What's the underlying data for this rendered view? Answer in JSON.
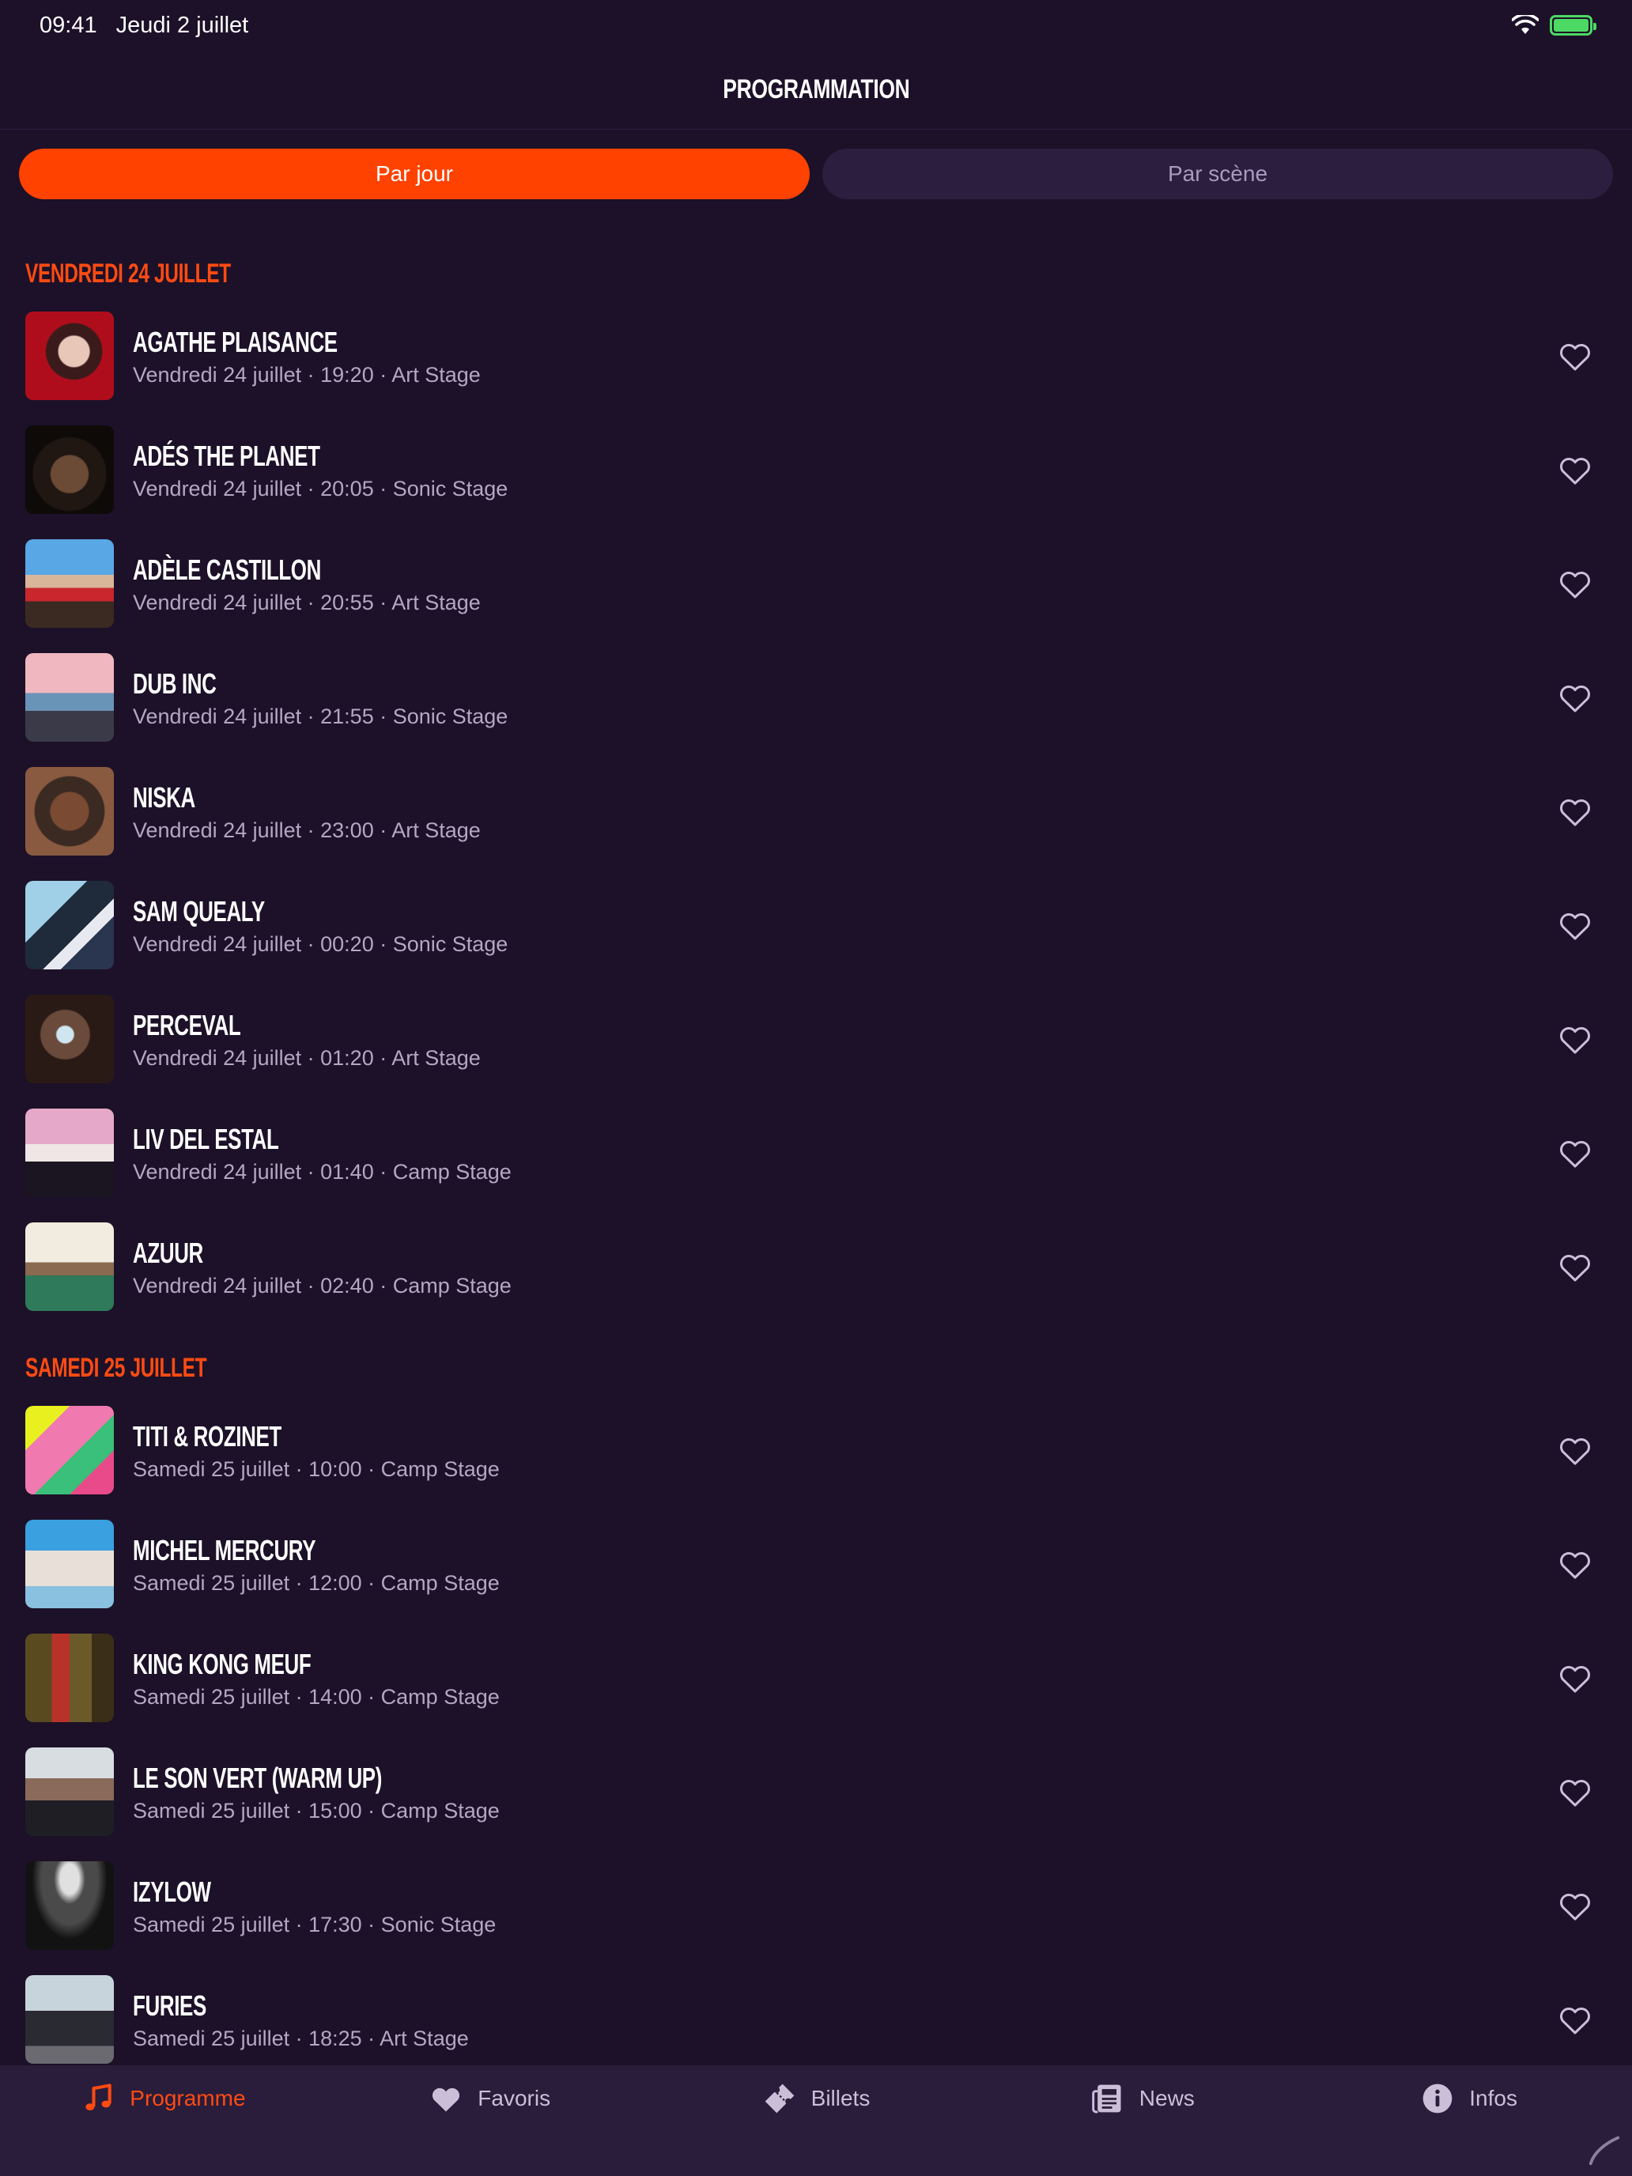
{
  "status_bar": {
    "time": "09:41",
    "date": "Jeudi 2 juillet"
  },
  "header": {
    "title": "PROGRAMMATION"
  },
  "segments": {
    "by_day": "Par jour",
    "by_stage": "Par scène"
  },
  "days": [
    {
      "label": "VENDREDI 24 JUILLET",
      "artists": [
        {
          "name": "AGATHE PLAISANCE",
          "details": "Vendredi 24 juillet · 19:20 · Art Stage"
        },
        {
          "name": "ADÉS THE PLANET",
          "details": "Vendredi 24 juillet · 20:05 · Sonic Stage"
        },
        {
          "name": "ADÈLE CASTILLON",
          "details": "Vendredi 24 juillet · 20:55 · Art Stage"
        },
        {
          "name": "DUB INC",
          "details": "Vendredi 24 juillet · 21:55 · Sonic Stage"
        },
        {
          "name": "NISKA",
          "details": "Vendredi 24 juillet · 23:00 · Art Stage"
        },
        {
          "name": "SAM QUEALY",
          "details": "Vendredi 24 juillet · 00:20 · Sonic Stage"
        },
        {
          "name": "PERCEVAL",
          "details": "Vendredi 24 juillet · 01:20 · Art Stage"
        },
        {
          "name": "LIV DEL ESTAL",
          "details": "Vendredi 24 juillet · 01:40 · Camp Stage"
        },
        {
          "name": "AZUUR",
          "details": "Vendredi 24 juillet · 02:40 · Camp Stage"
        }
      ]
    },
    {
      "label": "SAMEDI 25 JUILLET",
      "artists": [
        {
          "name": "TITI & ROZINET",
          "details": "Samedi 25 juillet · 10:00 · Camp Stage"
        },
        {
          "name": "MICHEL MERCURY",
          "details": "Samedi 25 juillet · 12:00 · Camp Stage"
        },
        {
          "name": "KING KONG MEUF",
          "details": "Samedi 25 juillet · 14:00 · Camp Stage"
        },
        {
          "name": "LE SON VERT (WARM UP)",
          "details": "Samedi 25 juillet · 15:00 · Camp Stage"
        },
        {
          "name": "IZYLOW",
          "details": "Samedi 25 juillet · 17:30 · Sonic Stage"
        },
        {
          "name": "FURIES",
          "details": "Samedi 25 juillet · 18:25 · Art Stage"
        }
      ]
    }
  ],
  "tabs": [
    {
      "label": "Programme",
      "icon": "music-note-icon",
      "active": true
    },
    {
      "label": "Favoris",
      "icon": "heart-icon",
      "active": false
    },
    {
      "label": "Billets",
      "icon": "ticket-icon",
      "active": false
    },
    {
      "label": "News",
      "icon": "newspaper-icon",
      "active": false
    },
    {
      "label": "Infos",
      "icon": "info-icon",
      "active": false
    }
  ],
  "colors": {
    "background": "#1c1128",
    "accent": "#ff4200",
    "tab_bar": "#2a1c3b",
    "muted_text": "#b3a8c2"
  }
}
